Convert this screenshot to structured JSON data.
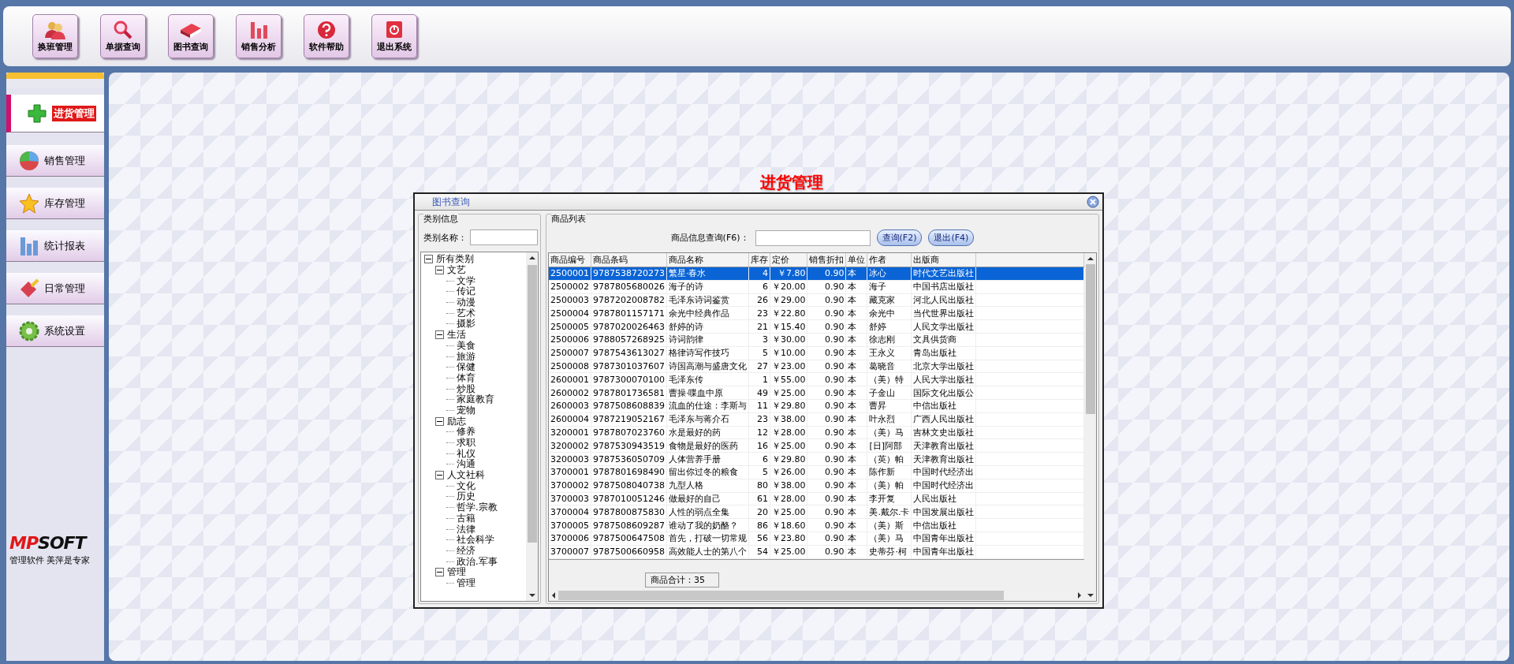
{
  "toolbar": {
    "buttons": [
      {
        "label": "换班管理",
        "kind": "people"
      },
      {
        "label": "单据查询",
        "kind": "search"
      },
      {
        "label": "图书查询",
        "kind": "book"
      },
      {
        "label": "销售分析",
        "kind": "chart"
      },
      {
        "label": "软件帮助",
        "kind": "help"
      },
      {
        "label": "退出系统",
        "kind": "exit"
      }
    ]
  },
  "sidebar": {
    "items": [
      {
        "label": "进货管理",
        "kind": "plus",
        "selected": true
      },
      {
        "label": "销售管理",
        "kind": "pie",
        "selected": false
      },
      {
        "label": "库存管理",
        "kind": "star",
        "selected": false
      },
      {
        "label": "统计报表",
        "kind": "bars",
        "selected": false
      },
      {
        "label": "日常管理",
        "kind": "brush",
        "selected": false
      },
      {
        "label": "系统设置",
        "kind": "gear",
        "selected": false
      }
    ],
    "logo_accent": "MP",
    "logo_rest": "SOFT",
    "slogan": "管理软件 美萍是专家"
  },
  "page_title": "进货管理",
  "dialog": {
    "title": "图书查询",
    "category_panel": {
      "legend": "类别信息",
      "search_label": "类别名称：",
      "tree": [
        {
          "label": "所有类别",
          "expanded": true,
          "children": [
            {
              "label": "文艺",
              "expanded": true,
              "children": [
                {
                  "label": "文学"
                },
                {
                  "label": "传记"
                },
                {
                  "label": "动漫"
                },
                {
                  "label": "艺术"
                },
                {
                  "label": "摄影"
                }
              ]
            },
            {
              "label": "生活",
              "expanded": true,
              "children": [
                {
                  "label": "美食"
                },
                {
                  "label": "旅游"
                },
                {
                  "label": "保健"
                },
                {
                  "label": "体育"
                },
                {
                  "label": "炒股"
                },
                {
                  "label": "家庭教育"
                },
                {
                  "label": "宠物"
                }
              ]
            },
            {
              "label": "励志",
              "expanded": true,
              "children": [
                {
                  "label": "修养"
                },
                {
                  "label": "求职"
                },
                {
                  "label": "礼仪"
                },
                {
                  "label": "沟通"
                }
              ]
            },
            {
              "label": "人文社科",
              "expanded": true,
              "children": [
                {
                  "label": "文化"
                },
                {
                  "label": "历史"
                },
                {
                  "label": "哲学.宗教"
                },
                {
                  "label": "古籍"
                },
                {
                  "label": "法律"
                },
                {
                  "label": "社会科学"
                },
                {
                  "label": "经济"
                },
                {
                  "label": "政治.军事"
                }
              ]
            },
            {
              "label": "管理",
              "expanded": true,
              "children": [
                {
                  "label": "管理"
                }
              ]
            }
          ]
        }
      ]
    },
    "product_panel": {
      "legend": "商品列表",
      "search_label": "商品信息查询(F6)：",
      "buttons": [
        "查询(F2)",
        "退出(F4)"
      ],
      "table": {
        "columns": [
          "商品编号",
          "商品条码",
          "商品名称",
          "库存",
          "定价",
          "销售折扣",
          "单位",
          "作者",
          "出版商"
        ],
        "rows": [
          {
            "selected": true,
            "cells": [
              "2500001",
              "9787538720273",
              "繁星·春水",
              "4",
              "￥7.80",
              "0.90",
              "本",
              "冰心",
              "时代文艺出版社"
            ]
          },
          {
            "selected": false,
            "cells": [
              "2500002",
              "9787805680026",
              "海子的诗",
              "6",
              "￥20.00",
              "0.90",
              "本",
              "海子",
              "中国书店出版社"
            ]
          },
          {
            "selected": false,
            "cells": [
              "2500003",
              "9787202008782",
              "毛泽东诗词鉴赏",
              "26",
              "￥29.00",
              "0.90",
              "本",
              "藏克家",
              "河北人民出版社"
            ]
          },
          {
            "selected": false,
            "cells": [
              "2500004",
              "9787801157171",
              "余光中经典作品",
              "23",
              "￥22.80",
              "0.90",
              "本",
              "余光中",
              "当代世界出版社"
            ]
          },
          {
            "selected": false,
            "cells": [
              "2500005",
              "9787020026463",
              "舒婷的诗",
              "21",
              "￥15.40",
              "0.90",
              "本",
              "舒婷",
              "人民文学出版社"
            ]
          },
          {
            "selected": false,
            "cells": [
              "2500006",
              "9788057268925",
              "诗词韵律",
              "3",
              "￥30.00",
              "0.90",
              "本",
              "徐志刚",
              "文具供货商"
            ]
          },
          {
            "selected": false,
            "cells": [
              "2500007",
              "9787543613027",
              "格律诗写作技巧",
              "5",
              "￥10.00",
              "0.90",
              "本",
              "王永义",
              "青岛出版社"
            ]
          },
          {
            "selected": false,
            "cells": [
              "2500008",
              "9787301037607",
              "诗国高潮与盛唐文化",
              "27",
              "￥23.00",
              "0.90",
              "本",
              "葛晓音",
              "北京大学出版社"
            ]
          },
          {
            "selected": false,
            "cells": [
              "2600001",
              "9787300070100",
              "毛泽东传",
              "1",
              "￥55.00",
              "0.90",
              "本",
              "（美）特",
              "人民大学出版社"
            ]
          },
          {
            "selected": false,
            "cells": [
              "2600002",
              "9787801736581",
              "曹操·喋血中原",
              "49",
              "￥25.00",
              "0.90",
              "本",
              "子金山",
              "国际文化出版公"
            ]
          },
          {
            "selected": false,
            "cells": [
              "2600003",
              "9787508608839",
              "流血的仕途：李斯与",
              "11",
              "￥29.80",
              "0.90",
              "本",
              "曹昇",
              "中信出版社"
            ]
          },
          {
            "selected": false,
            "cells": [
              "2600004",
              "9787219052167",
              "毛泽东与蒋介石",
              "23",
              "￥38.00",
              "0.90",
              "本",
              "叶永烈",
              "广西人民出版社"
            ]
          },
          {
            "selected": false,
            "cells": [
              "3200001",
              "9787807023760",
              "水是最好的药",
              "12",
              "￥28.00",
              "0.90",
              "本",
              "（美）马",
              "吉林文史出版社"
            ]
          },
          {
            "selected": false,
            "cells": [
              "3200002",
              "9787530943519",
              "食物是最好的医药",
              "16",
              "￥25.00",
              "0.90",
              "本",
              "[日]阿部",
              "天津教育出版社"
            ]
          },
          {
            "selected": false,
            "cells": [
              "3200003",
              "9787536050709",
              "人体营养手册",
              "6",
              "￥29.80",
              "0.90",
              "本",
              "（英）帕",
              "天津教育出版社"
            ]
          },
          {
            "selected": false,
            "cells": [
              "3700001",
              "9787801698490",
              "留出你过冬的粮食",
              "5",
              "￥26.00",
              "0.90",
              "本",
              "陈作新",
              "中国时代经济出"
            ]
          },
          {
            "selected": false,
            "cells": [
              "3700002",
              "9787508040738",
              "九型人格",
              "80",
              "￥38.00",
              "0.90",
              "本",
              "（美）帕",
              "中国时代经济出"
            ]
          },
          {
            "selected": false,
            "cells": [
              "3700003",
              "9787010051246",
              "做最好的自己",
              "61",
              "￥28.00",
              "0.90",
              "本",
              "李开复",
              "人民出版社"
            ]
          },
          {
            "selected": false,
            "cells": [
              "3700004",
              "9787800875830",
              "人性的弱点全集",
              "20",
              "￥25.00",
              "0.90",
              "本",
              "美.戴尔.卡",
              "中国发展出版社"
            ]
          },
          {
            "selected": false,
            "cells": [
              "3700005",
              "9787508609287",
              "谁动了我的奶酪？",
              "86",
              "￥18.60",
              "0.90",
              "本",
              "（美）斯",
              "中信出版社"
            ]
          },
          {
            "selected": false,
            "cells": [
              "3700006",
              "9787500647508",
              "首先，打破一切常规",
              "56",
              "￥23.80",
              "0.90",
              "本",
              "（美）马",
              "中国青年出版社"
            ]
          },
          {
            "selected": false,
            "cells": [
              "3700007",
              "9787500660958",
              "高效能人士的第八个",
              "54",
              "￥25.00",
              "0.90",
              "本",
              "史蒂芬·柯",
              "中国青年出版社"
            ]
          }
        ]
      },
      "total": "商品合计：35"
    }
  }
}
